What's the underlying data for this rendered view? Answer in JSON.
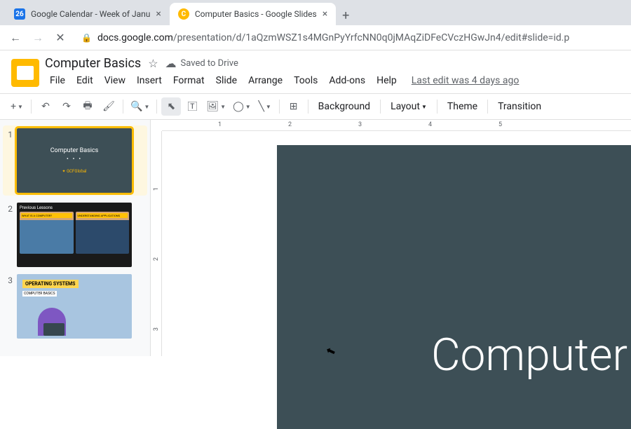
{
  "browser": {
    "tabs": [
      {
        "title": "Google Calendar - Week of Janu",
        "favicon_text": "26",
        "favicon_bg": "#1a73e8"
      },
      {
        "title": "Computer Basics - Google Slides",
        "favicon_text": "C",
        "favicon_bg": "#ffba00"
      }
    ],
    "url_domain": "docs.google.com",
    "url_path": "/presentation/d/1aQzmWSZ1s4MGnPyYrfcNN0q0jMAqZiDFeCVczHGwJn4/edit#slide=id.p"
  },
  "doc": {
    "title": "Computer Basics",
    "saved_text": "Saved to Drive",
    "last_edit": "Last edit was 4 days ago"
  },
  "menu": [
    "File",
    "Edit",
    "View",
    "Insert",
    "Format",
    "Slide",
    "Arrange",
    "Tools",
    "Add-ons",
    "Help"
  ],
  "toolbar": {
    "background": "Background",
    "layout": "Layout",
    "theme": "Theme",
    "transition": "Transition"
  },
  "slides": [
    {
      "num": "1",
      "title": "Computer Basics",
      "logo": "✦ GCFGlobal"
    },
    {
      "num": "2",
      "header": "Previous Lessons",
      "card1": "WHAT IS A COMPUTER?",
      "card2": "UNDERSTANDING APPLICATIONS"
    },
    {
      "num": "3",
      "banner": "OPERATING SYSTEMS",
      "sub": "COMPUTER BASICS"
    }
  ],
  "canvas": {
    "title": "Computer",
    "dots": "• • •"
  },
  "ruler_h": [
    "1",
    "2",
    "3",
    "4",
    "5"
  ],
  "ruler_v": [
    "1",
    "2",
    "3"
  ]
}
